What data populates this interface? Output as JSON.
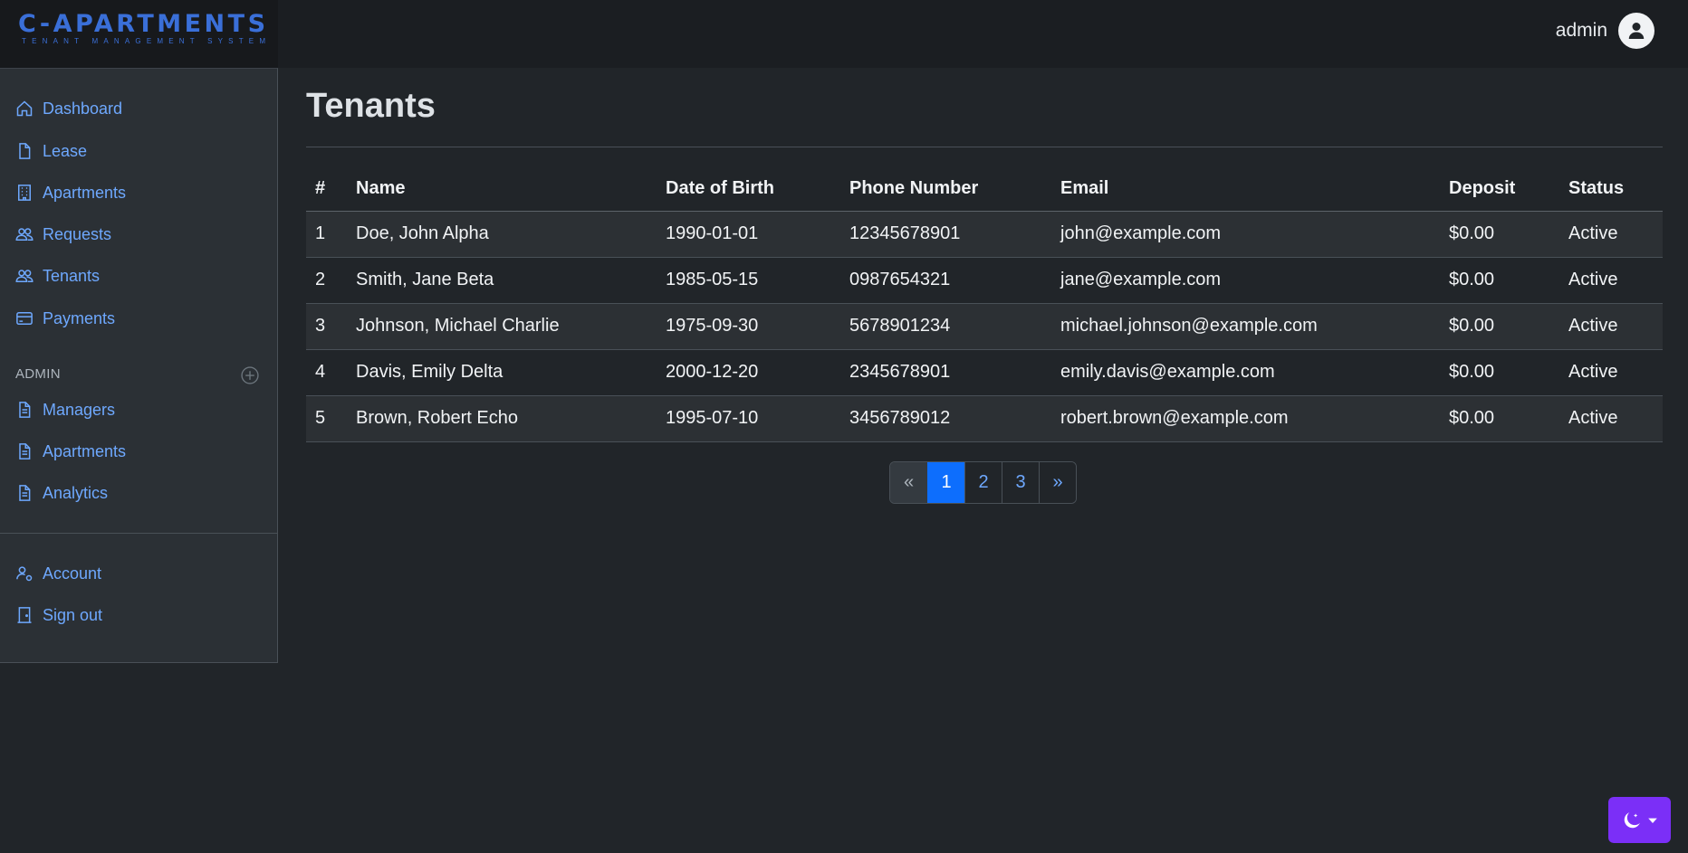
{
  "brand": {
    "title": "C-APARTMENTS",
    "subtitle": "TENANT MANAGEMENT SYSTEM"
  },
  "header": {
    "user": "admin"
  },
  "sidebar": {
    "items": [
      {
        "label": "Dashboard",
        "icon": "house-icon"
      },
      {
        "label": "Lease",
        "icon": "file-icon"
      },
      {
        "label": "Apartments",
        "icon": "building-icon"
      },
      {
        "label": "Requests",
        "icon": "people-icon"
      },
      {
        "label": "Tenants",
        "icon": "people-icon"
      },
      {
        "label": "Payments",
        "icon": "credit-card-icon"
      }
    ],
    "admin_heading": "ADMIN",
    "admin_items": [
      {
        "label": "Managers",
        "icon": "file-text-icon"
      },
      {
        "label": "Apartments",
        "icon": "file-text-icon"
      },
      {
        "label": "Analytics",
        "icon": "file-text-icon"
      }
    ],
    "bottom_items": [
      {
        "label": "Account",
        "icon": "person-gear-icon"
      },
      {
        "label": "Sign out",
        "icon": "door-icon"
      }
    ]
  },
  "main": {
    "title": "Tenants",
    "table": {
      "headers": [
        "#",
        "Name",
        "Date of Birth",
        "Phone Number",
        "Email",
        "Deposit",
        "Status"
      ],
      "rows": [
        [
          "1",
          "Doe, John Alpha",
          "1990-01-01",
          "12345678901",
          "john@example.com",
          "$0.00",
          "Active"
        ],
        [
          "2",
          "Smith, Jane Beta",
          "1985-05-15",
          "0987654321",
          "jane@example.com",
          "$0.00",
          "Active"
        ],
        [
          "3",
          "Johnson, Michael Charlie",
          "1975-09-30",
          "5678901234",
          "michael.johnson@example.com",
          "$0.00",
          "Active"
        ],
        [
          "4",
          "Davis, Emily Delta",
          "2000-12-20",
          "2345678901",
          "emily.davis@example.com",
          "$0.00",
          "Active"
        ],
        [
          "5",
          "Brown, Robert Echo",
          "1995-07-10",
          "3456789012",
          "robert.brown@example.com",
          "$0.00",
          "Active"
        ]
      ]
    },
    "pagination": [
      "«",
      "1",
      "2",
      "3",
      "»"
    ],
    "active_page": "1"
  },
  "colors": {
    "accent": "#6ea8fe",
    "primary": "#0d6efd",
    "theme_button": "#7b2ff7"
  },
  "theme_toggle": {
    "icon": "moon-stars-icon"
  }
}
